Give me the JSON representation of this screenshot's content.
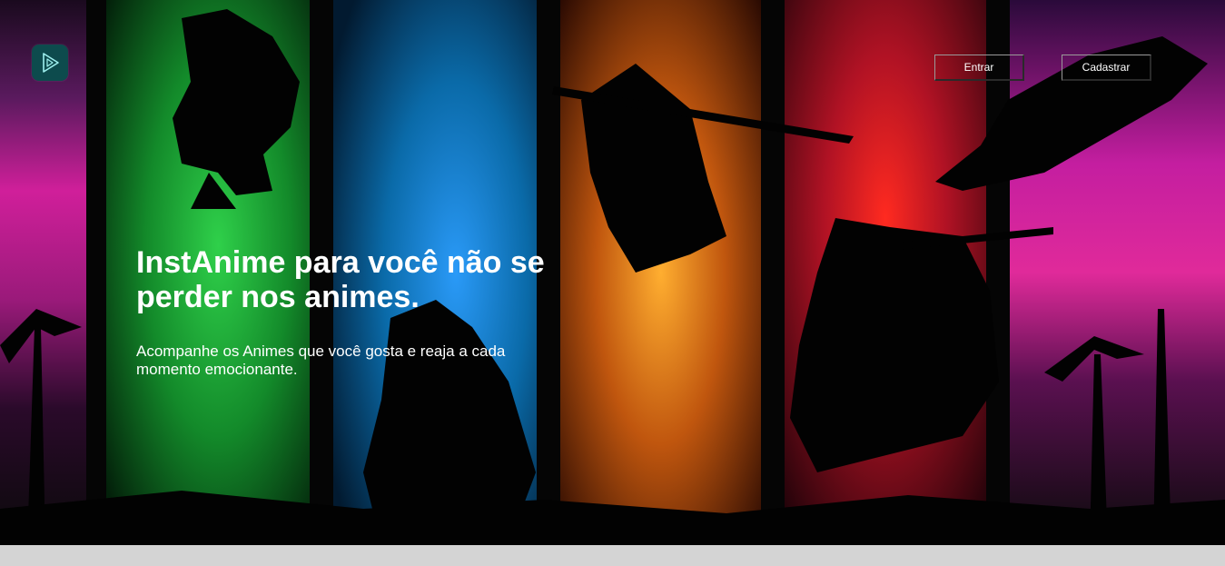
{
  "header": {
    "logo_icon": "play-triangle-icon",
    "login_label": "Entrar",
    "signup_label": "Cadastrar"
  },
  "hero": {
    "headline": "InstAnime para você não se perder nos animes.",
    "subtext": "Acompanhe os Animes que você gosta e reaja a cada momento emocionante."
  },
  "colors": {
    "logo_bg": "#0d4b4d",
    "logo_stroke": "#9ef0ee",
    "panel_green": "#1fae3c",
    "panel_blue": "#1b8fe6",
    "panel_orange": "#f0901e",
    "panel_red": "#e8281e",
    "panel_magenta": "#d8208e",
    "footer_bg": "#d4d4d4"
  }
}
